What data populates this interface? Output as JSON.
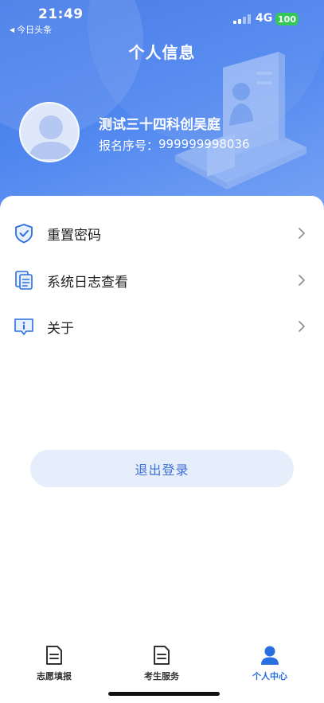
{
  "status_bar": {
    "time": "21:49",
    "back_app": "今日头条",
    "network": "4G",
    "battery": "100"
  },
  "header": {
    "title": "个人信息",
    "user_name": "测试三十四科创吴庭",
    "reg_label": "报名序号：",
    "reg_number": "999999998036"
  },
  "menu": [
    {
      "label": "重置密码",
      "icon": "shield-check-icon"
    },
    {
      "label": "系统日志查看",
      "icon": "document-copy-icon"
    },
    {
      "label": "关于",
      "icon": "info-bubble-icon"
    }
  ],
  "logout_label": "退出登录",
  "tabs": [
    {
      "label": "志愿填报",
      "icon": "document-icon",
      "active": false
    },
    {
      "label": "考生服务",
      "icon": "document-icon",
      "active": false
    },
    {
      "label": "个人中心",
      "icon": "person-icon",
      "active": true
    }
  ],
  "colors": {
    "accent": "#2a6fe0",
    "header_gradient_start": "#3f76e6",
    "header_gradient_end": "#7aa6f4",
    "logout_bg": "#e6eefc",
    "battery": "#34c759"
  }
}
